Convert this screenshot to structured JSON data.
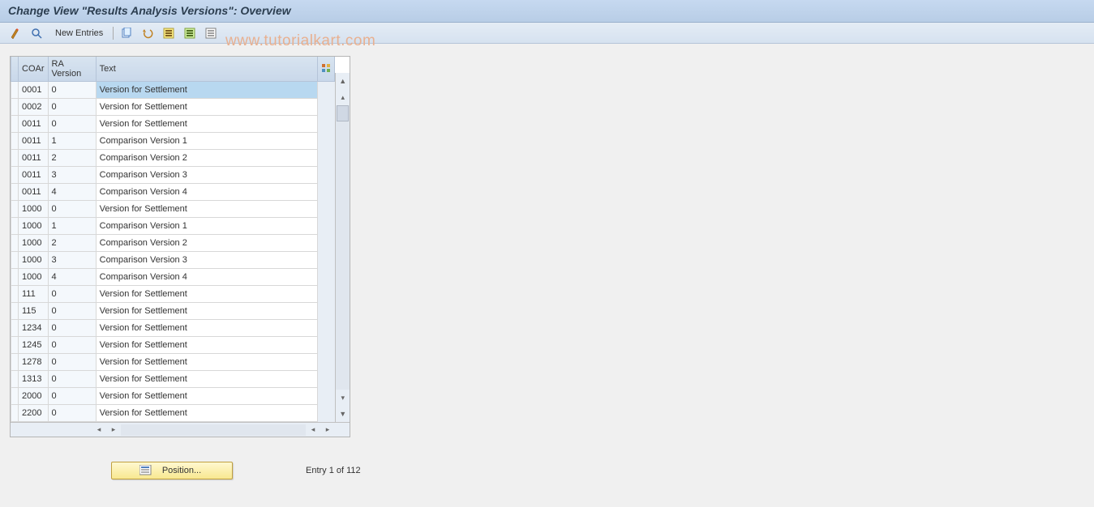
{
  "title": "Change View \"Results Analysis Versions\": Overview",
  "toolbar": {
    "new_entries": "New Entries"
  },
  "watermark": "www.tutorialkart.com",
  "columns": {
    "coar": "COAr",
    "ra_version": "RA Version",
    "text": "Text"
  },
  "rows": [
    {
      "coar": "0001",
      "ra": "0",
      "text": "Version for Settlement",
      "selected": true
    },
    {
      "coar": "0002",
      "ra": "0",
      "text": "Version for Settlement"
    },
    {
      "coar": "0011",
      "ra": "0",
      "text": "Version for Settlement"
    },
    {
      "coar": "0011",
      "ra": "1",
      "text": "Comparison Version 1"
    },
    {
      "coar": "0011",
      "ra": "2",
      "text": "Comparison Version 2"
    },
    {
      "coar": "0011",
      "ra": "3",
      "text": "Comparison Version 3"
    },
    {
      "coar": "0011",
      "ra": "4",
      "text": "Comparison Version 4"
    },
    {
      "coar": "1000",
      "ra": "0",
      "text": "Version for Settlement"
    },
    {
      "coar": "1000",
      "ra": "1",
      "text": "Comparison Version 1"
    },
    {
      "coar": "1000",
      "ra": "2",
      "text": "Comparison Version 2"
    },
    {
      "coar": "1000",
      "ra": "3",
      "text": "Comparison Version 3"
    },
    {
      "coar": "1000",
      "ra": "4",
      "text": "Comparison Version 4"
    },
    {
      "coar": "111",
      "ra": "0",
      "text": "Version for Settlement"
    },
    {
      "coar": "115",
      "ra": "0",
      "text": "Version for Settlement"
    },
    {
      "coar": "1234",
      "ra": "0",
      "text": "Version for Settlement"
    },
    {
      "coar": "1245",
      "ra": "0",
      "text": "Version for Settlement"
    },
    {
      "coar": "1278",
      "ra": "0",
      "text": "Version for Settlement"
    },
    {
      "coar": "1313",
      "ra": "0",
      "text": "Version for Settlement"
    },
    {
      "coar": "2000",
      "ra": "0",
      "text": "Version for Settlement"
    },
    {
      "coar": "2200",
      "ra": "0",
      "text": "Version for Settlement"
    }
  ],
  "position_label": "Position...",
  "entry_info": "Entry 1 of 112"
}
